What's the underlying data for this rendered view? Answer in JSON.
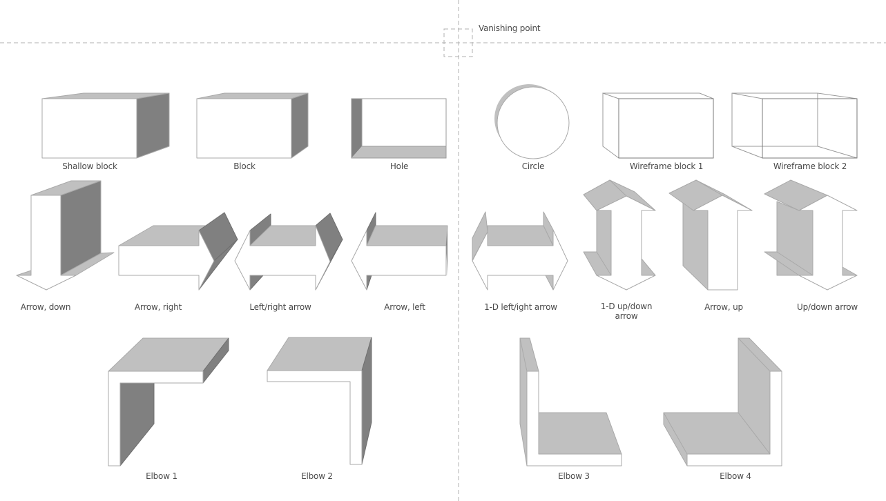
{
  "vanishing_point": {
    "label": "Vanishing point"
  },
  "colors": {
    "front_face": "#ffffff",
    "light_face": "#c0c0c0",
    "dark_face": "#808080",
    "edge": "#a9a9a9",
    "guide": "#b0b0b0",
    "label_text": "#4a4a4a"
  },
  "shapes": [
    {
      "id": "shallow-block",
      "label": "Shallow block"
    },
    {
      "id": "block",
      "label": "Block"
    },
    {
      "id": "hole",
      "label": "Hole"
    },
    {
      "id": "circle",
      "label": "Circle"
    },
    {
      "id": "wireframe-block-1",
      "label": "Wireframe block 1"
    },
    {
      "id": "wireframe-block-2",
      "label": "Wireframe block 2"
    },
    {
      "id": "arrow-down",
      "label": "Arrow, down"
    },
    {
      "id": "arrow-right",
      "label": "Arrow, right"
    },
    {
      "id": "left-right-arrow",
      "label": "Left/right arrow"
    },
    {
      "id": "arrow-left",
      "label": "Arrow, left"
    },
    {
      "id": "one-d-left-right-arrow",
      "label": "1-D left/ight arrow"
    },
    {
      "id": "one-d-up-down-arrow",
      "label": "1-D up/down arrow"
    },
    {
      "id": "arrow-up",
      "label": "Arrow, up"
    },
    {
      "id": "up-down-arrow",
      "label": "Up/down arrow"
    },
    {
      "id": "elbow-1",
      "label": "Elbow 1"
    },
    {
      "id": "elbow-2",
      "label": "Elbow 2"
    },
    {
      "id": "elbow-3",
      "label": "Elbow 3"
    },
    {
      "id": "elbow-4",
      "label": "Elbow 4"
    }
  ]
}
